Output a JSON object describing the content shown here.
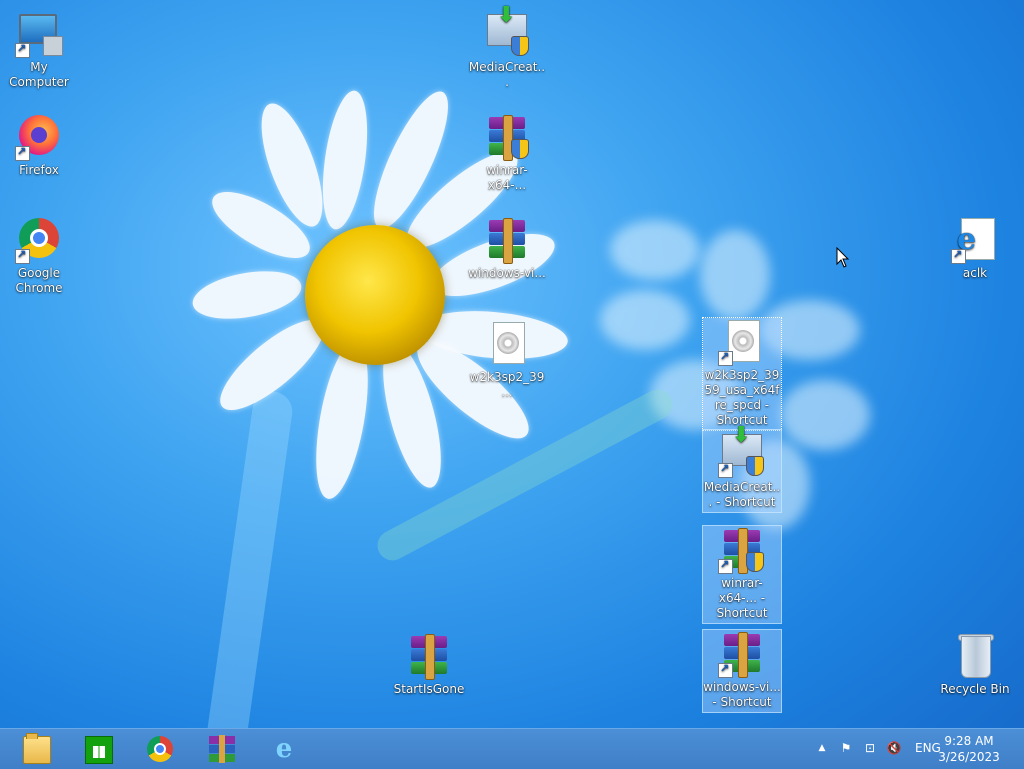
{
  "desktop": {
    "icons": [
      {
        "name": "my-computer",
        "label": "My Computer"
      },
      {
        "name": "firefox",
        "label": "Firefox"
      },
      {
        "name": "google-chrome",
        "label": "Google Chrome"
      },
      {
        "name": "mediacreation",
        "label": "MediaCreat..."
      },
      {
        "name": "winrar-x64",
        "label": "winrar-x64-..."
      },
      {
        "name": "windows-vi",
        "label": "windows-vi..."
      },
      {
        "name": "w2k3sp2",
        "label": "w2k3sp2_39..."
      },
      {
        "name": "startisgone",
        "label": "StartIsGone"
      },
      {
        "name": "aclk",
        "label": "aclk"
      },
      {
        "name": "w2k3sp2-shortcut",
        "label": "w2k3sp2_3959_usa_x64fre_spcd - Shortcut"
      },
      {
        "name": "mediacreation-shortcut",
        "label": "MediaCreat... - Shortcut"
      },
      {
        "name": "winrar-shortcut",
        "label": "winrar-x64-... - Shortcut"
      },
      {
        "name": "windows-vi-shortcut",
        "label": "windows-vi... - Shortcut"
      },
      {
        "name": "recycle-bin",
        "label": "Recycle Bin"
      }
    ]
  },
  "taskbar": {
    "pinned": [
      "file-explorer-icon",
      "store-icon",
      "chrome-icon",
      "winrar-icon",
      "internet-explorer-icon"
    ],
    "tray": {
      "language": "ENG",
      "time": "9:28 AM",
      "date": "3/26/2023"
    }
  },
  "colors": {
    "taskbar": "#4c8fd6",
    "desktop_blue": "#3ea3f0"
  }
}
